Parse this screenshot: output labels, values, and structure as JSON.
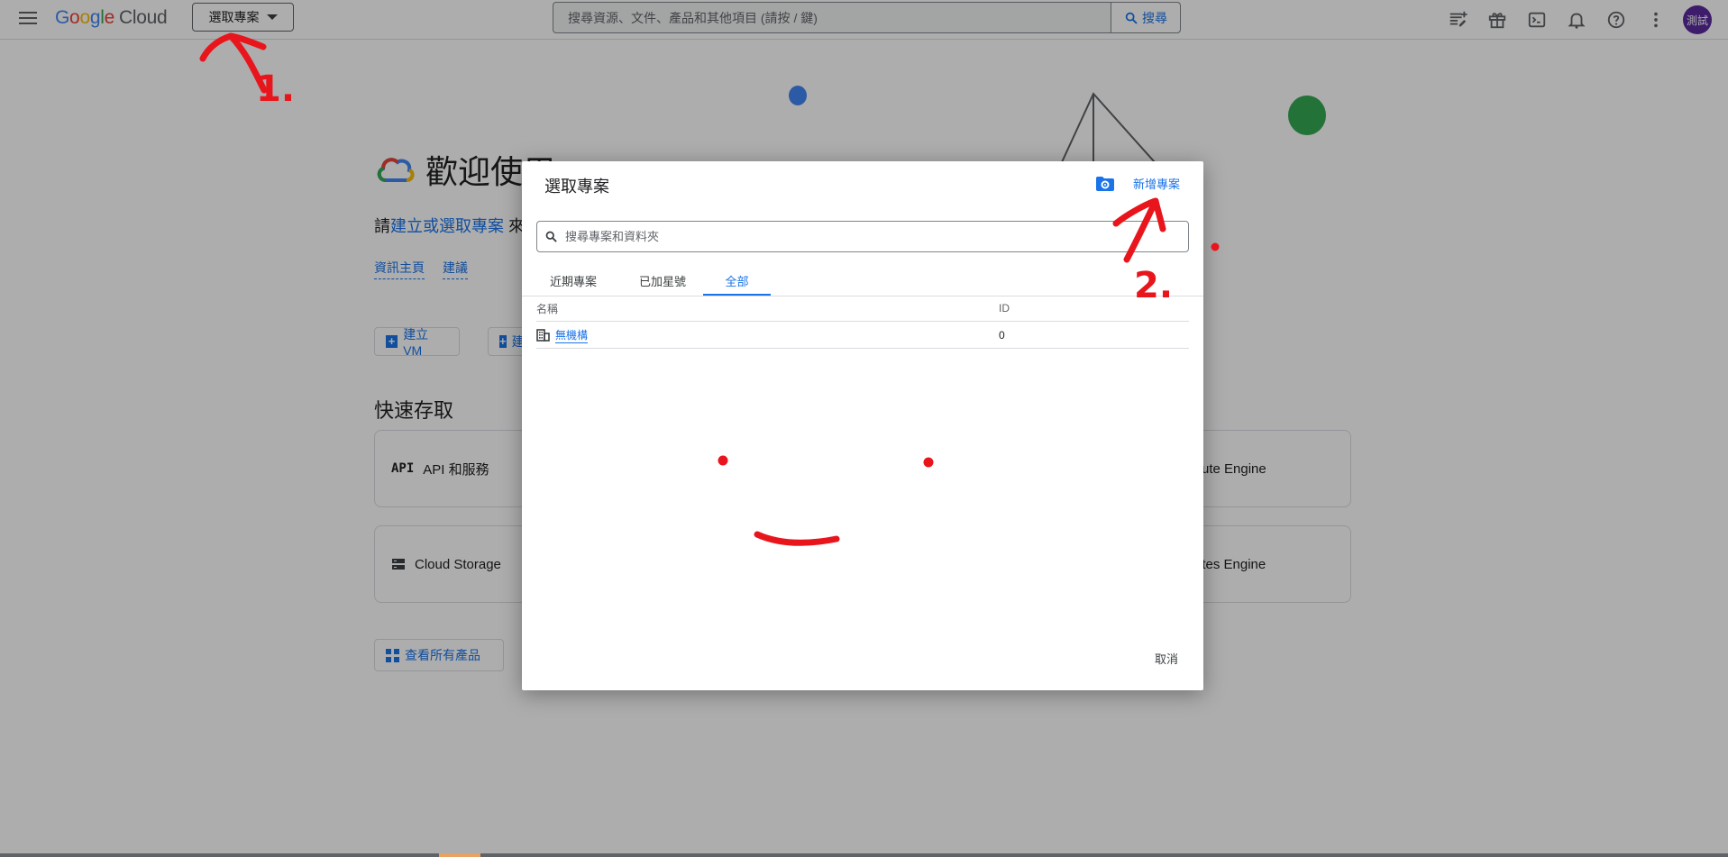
{
  "header": {
    "logo_google": "Google",
    "logo_cloud": "Cloud",
    "project_picker_label": "選取專案",
    "search_placeholder": "搜尋資源、文件、產品和其他項目 (請按 / 鍵)",
    "search_button_label": "搜尋",
    "avatar_text": "測試",
    "icons": [
      "edit-note-icon",
      "gift-icon",
      "terminal-icon",
      "bell-icon",
      "help-icon",
      "more-vert-icon"
    ]
  },
  "background_page": {
    "welcome_title": "歡迎使用",
    "welcome_sub_prefix": "請",
    "welcome_sub_link": "建立或選取專案",
    "welcome_sub_suffix": "來",
    "links": [
      "資訊主頁",
      "建議"
    ],
    "buttons": [
      "建立 VM",
      "建"
    ],
    "quick_access_title": "快速存取",
    "cards": {
      "api": "API 和服務",
      "compute": "ute Engine",
      "storage": "Cloud Storage",
      "kubernetes": "etes Engine"
    },
    "view_all_products": "查看所有產品"
  },
  "dialog": {
    "title": "選取專案",
    "new_project_label": "新增專案",
    "search_placeholder": "搜尋專案和資料夾",
    "tabs": [
      "近期專案",
      "已加星號",
      "全部"
    ],
    "active_tab": "全部",
    "table": {
      "columns": [
        "名稱",
        "ID"
      ],
      "rows": [
        {
          "name": "無機構",
          "id": "0"
        }
      ]
    },
    "cancel_label": "取消"
  },
  "annotations": {
    "step1": "1.",
    "step2": "2."
  },
  "colors": {
    "accent": "#1a73e8",
    "annotation": "#e8161c",
    "avatar": "#5b2a9e"
  }
}
